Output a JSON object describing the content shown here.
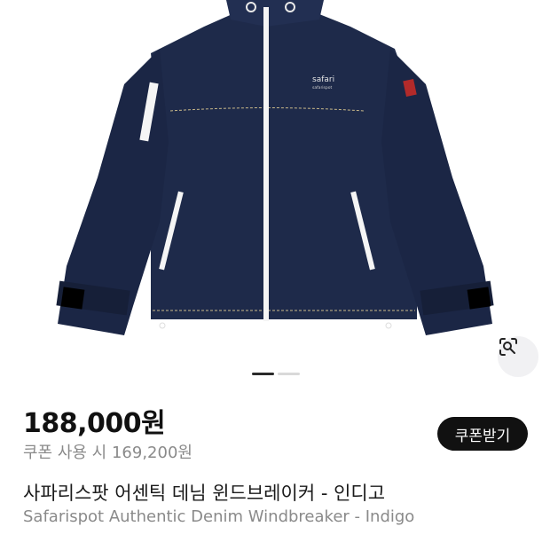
{
  "product": {
    "image_label": "safari",
    "image_sublabel": "safarispot",
    "price": "188,000원",
    "coupon_price": "쿠폰 사용 시 169,200원",
    "coupon_button": "쿠폰받기",
    "title_ko": "사파리스팟 어센틱 데님 윈드브레이커 - 인디고",
    "title_en": "Safarispot Authentic Denim Windbreaker - Indigo"
  },
  "carousel": {
    "total": 2,
    "active": 1
  },
  "icons": {
    "lens": "visual-search-icon"
  },
  "colors": {
    "jacket": "#1e2a4a",
    "button": "#111111",
    "muted_text": "#8a8a8a"
  }
}
